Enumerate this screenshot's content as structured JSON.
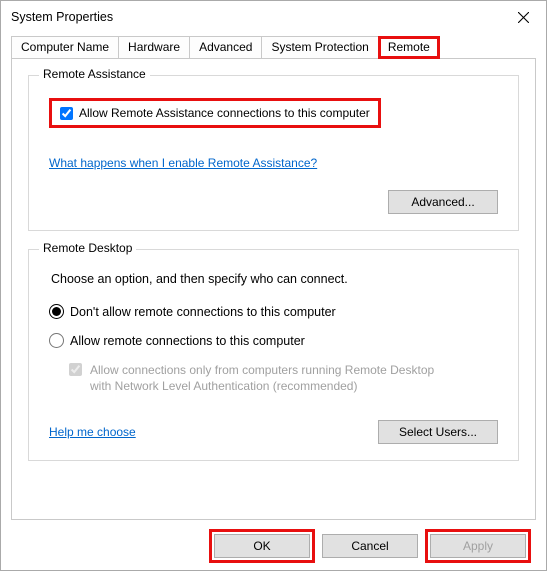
{
  "window": {
    "title": "System Properties"
  },
  "tabs": {
    "computer_name": "Computer Name",
    "hardware": "Hardware",
    "advanced": "Advanced",
    "system_protection": "System Protection",
    "remote": "Remote"
  },
  "remote_assist": {
    "legend": "Remote Assistance",
    "allow_label": "Allow Remote Assistance connections to this computer",
    "help_link": "What happens when I enable Remote Assistance?",
    "advanced_btn": "Advanced..."
  },
  "remote_desktop": {
    "legend": "Remote Desktop",
    "intro": "Choose an option, and then specify who can connect.",
    "opt_dont": "Don't allow remote connections to this computer",
    "opt_allow": "Allow remote connections to this computer",
    "nla_line1": "Allow connections only from computers running Remote Desktop",
    "nla_line2": "with Network Level Authentication (recommended)",
    "help_link": "Help me choose",
    "select_users_btn": "Select Users..."
  },
  "buttons": {
    "ok": "OK",
    "cancel": "Cancel",
    "apply": "Apply"
  }
}
